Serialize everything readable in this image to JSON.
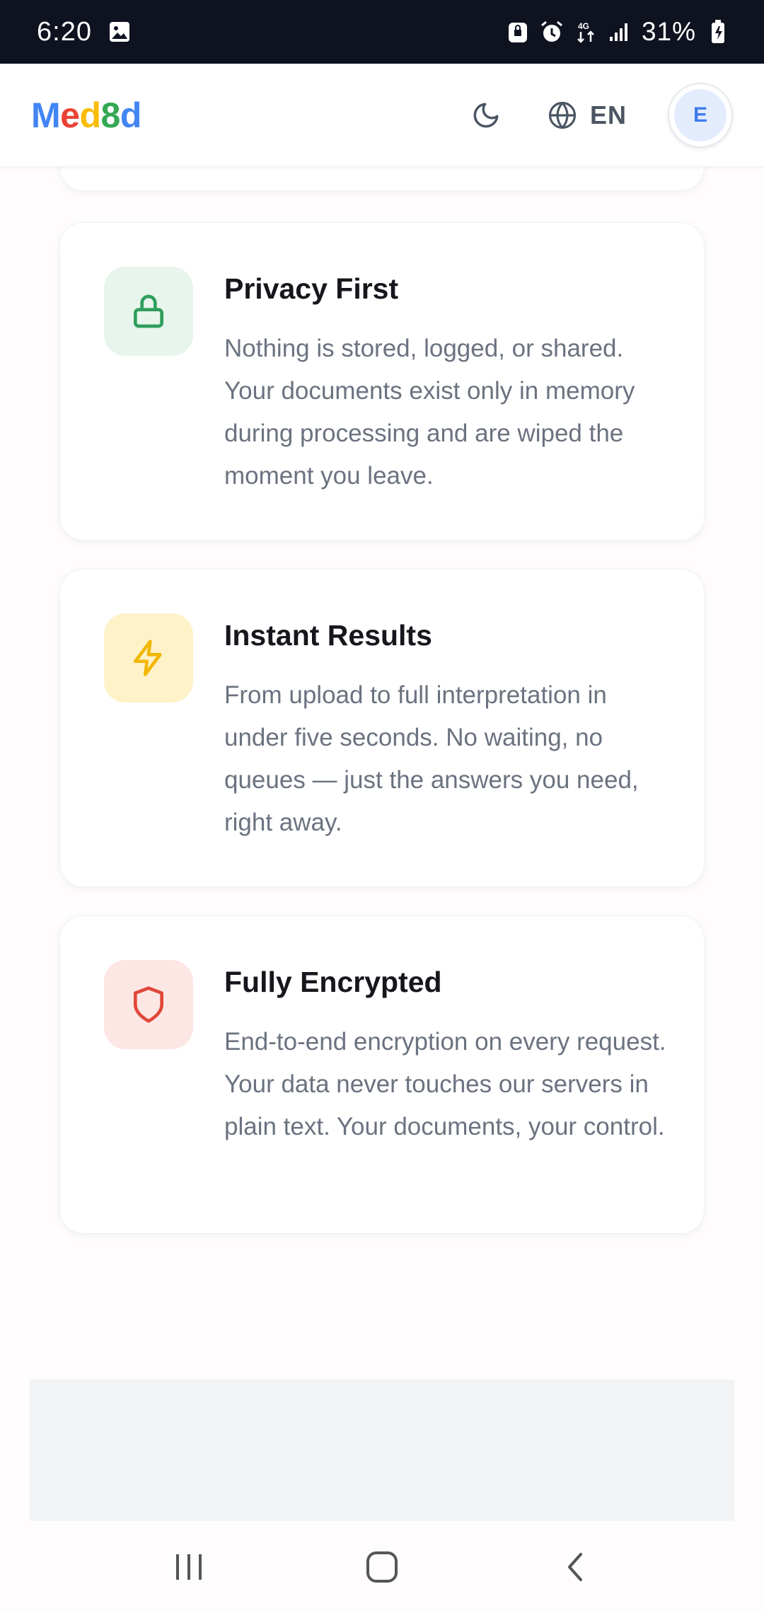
{
  "status_bar": {
    "time": "6:20",
    "battery": "31%",
    "icons": [
      "gallery-icon",
      "vpn-lock-icon",
      "alarm-icon",
      "data-transfer-icon",
      "signal-icon",
      "battery-charging-icon"
    ]
  },
  "header": {
    "logo_letters": [
      {
        "char": "M",
        "color": "#4285F4"
      },
      {
        "char": "e",
        "color": "#EA4335"
      },
      {
        "char": "d",
        "color": "#FBBC05"
      },
      {
        "char": "8",
        "color": "#34A853"
      },
      {
        "char": "d",
        "color": "#4285F4"
      }
    ],
    "theme_icon": "moon-icon",
    "language": "EN",
    "language_icon": "globe-icon",
    "avatar_initial": "E"
  },
  "features": [
    {
      "title": "Privacy First",
      "description": "Nothing is stored, logged, or shared. Your documents exist only in memory during processing and are wiped the moment you leave.",
      "icon": "lock-icon",
      "icon_color": "#2e9e5b",
      "icon_bg": "#e7f5ec"
    },
    {
      "title": "Instant Results",
      "description": "From upload to full interpretation in under five seconds. No waiting, no queues — just the answers you need, right away.",
      "icon": "lightning-icon",
      "icon_color": "#f2b705",
      "icon_bg": "#fdf2c8"
    },
    {
      "title": "Fully Encrypted",
      "description": "End-to-end encryption on every request. Your data never touches our servers in plain text. Your documents, your control.",
      "icon": "shield-icon",
      "icon_color": "#e0483a",
      "icon_bg": "#fde7e5"
    }
  ],
  "nav_bar": {
    "buttons": [
      "recent-apps-icon",
      "home-icon",
      "back-icon"
    ]
  }
}
